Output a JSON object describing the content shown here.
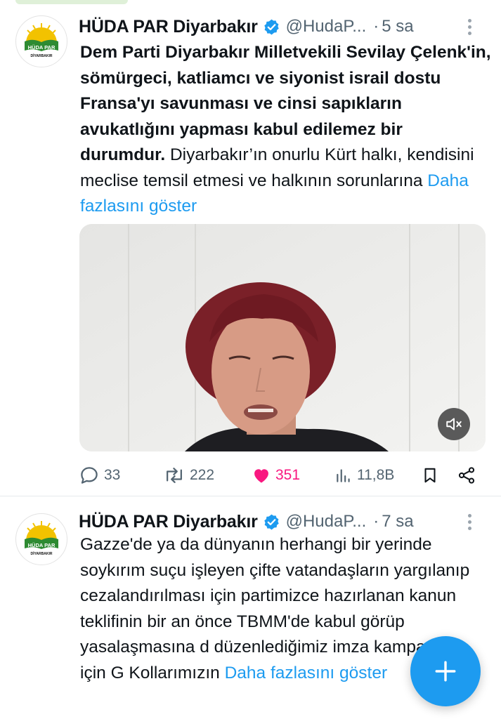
{
  "colors": {
    "accent": "#1d9bf0",
    "like": "#f91880",
    "muted_text": "#536471",
    "brand_green": "#2e8b32"
  },
  "tweets": [
    {
      "author_name": "HÜDA PAR Diyarbakır",
      "handle": "@HudaP...",
      "separator": "·",
      "time": "5 sa",
      "avatar": {
        "logo_text": "HÜDA PAR",
        "sub_text": "DİYARBAKIR"
      },
      "text_bold": "Dem Parti Diyarbakır Milletvekili Sevilay Çelenk'in, sömürgeci, katliamcı ve siyonist israil dostu Fransa'yı savunması ve cinsi sapıkların avukatlığını yapması kabul edilemez bir durumdur.",
      "text_normal": " Diyarbakır’ın onurlu Kürt halkı, kendisini meclise temsil etmesi ve halkının sorunlarına ",
      "show_more": "Daha fazlasını göster",
      "media": {
        "icon": "mute-icon"
      },
      "stats": {
        "replies": "33",
        "reposts": "222",
        "likes": "351",
        "views": "11,8B"
      }
    },
    {
      "author_name": "HÜDA PAR Diyarbakır",
      "handle": "@HudaP...",
      "separator": "·",
      "time": "7 sa",
      "avatar": {
        "logo_text": "HÜDA PAR",
        "sub_text": "DİYARBAKIR"
      },
      "text_normal": "Gazze'de ya da dünyanın herhangi bir yerinde soykırım suçu işleyen çifte vatandaşların yargılanıp cezalandırılması için partimizce hazırlanan kanun teklifinin bir an önce TBMM'de kabul görüp yasalaşmasına d düzenlediğimiz imza kampanyası için G Kollarımızın ",
      "show_more": "Daha fazlasını göster"
    }
  ],
  "fab": {
    "icon": "plus-icon"
  }
}
